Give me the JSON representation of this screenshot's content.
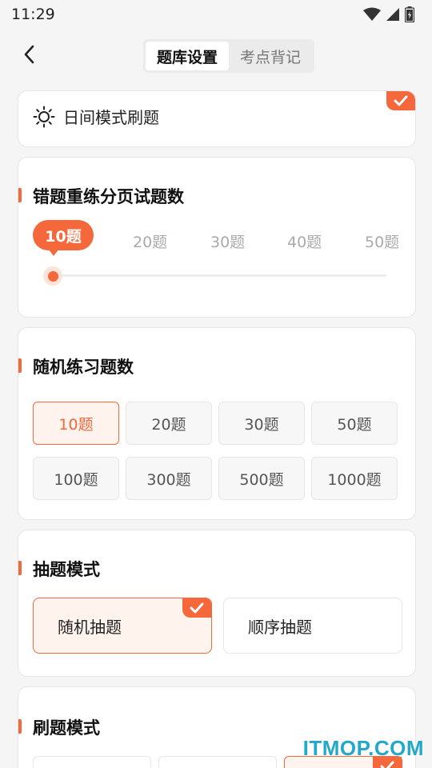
{
  "status_bar": {
    "time": "11:29"
  },
  "header": {
    "tabs": [
      {
        "label": "题库设置",
        "active": true
      },
      {
        "label": "考点背记",
        "active": false
      }
    ]
  },
  "day_mode": {
    "label": "日间模式刷题",
    "checked": true
  },
  "wrong_retry": {
    "title": "错题重练分页试题数",
    "selected": "10题",
    "options": [
      "20题",
      "30题",
      "40题",
      "50题"
    ]
  },
  "random_practice": {
    "title": "随机练习题数",
    "options": [
      "10题",
      "20题",
      "30题",
      "50题",
      "100题",
      "300题",
      "500题",
      "1000题"
    ],
    "selected_index": 0
  },
  "draw_mode": {
    "title": "抽题模式",
    "options": [
      "随机抽题",
      "顺序抽题"
    ],
    "selected_index": 0
  },
  "brush_mode": {
    "title": "刷题模式"
  },
  "watermark": "ITMOP.COM",
  "colors": {
    "accent": "#f5683c",
    "background": "#f5f5f5"
  }
}
